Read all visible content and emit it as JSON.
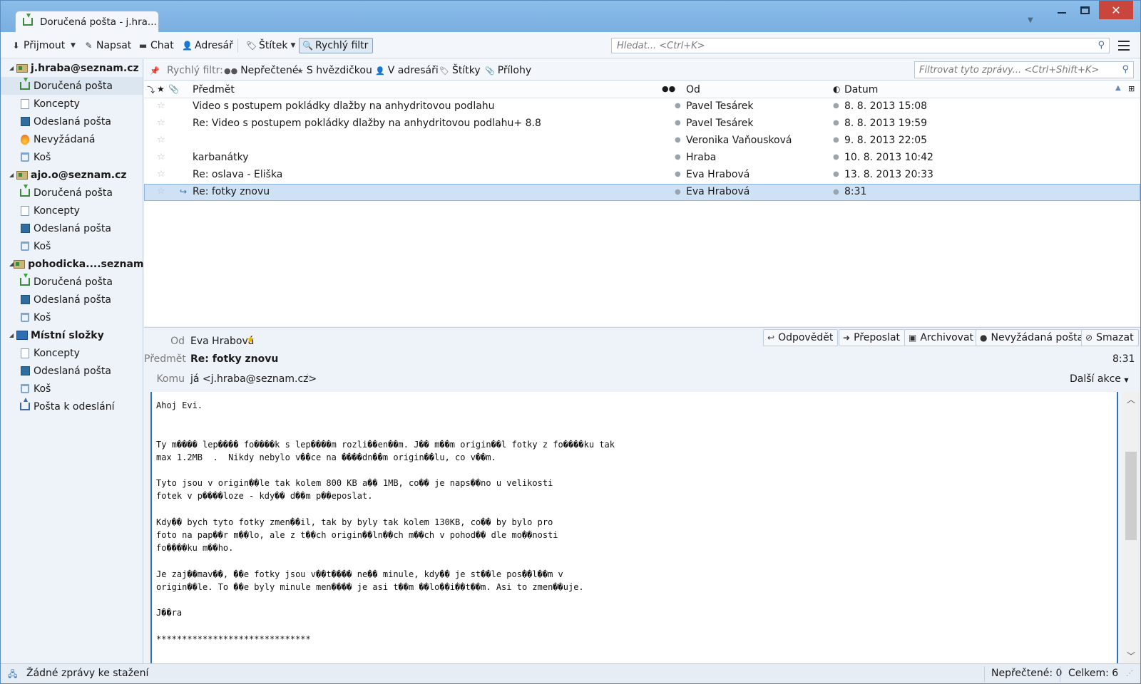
{
  "window": {
    "tab_title": "Doručená pošta - j.hra...",
    "close_glyph": "✕"
  },
  "toolbar": {
    "get_messages": "Přijmout",
    "write": "Napsat",
    "chat": "Chat",
    "address_book": "Adresář",
    "tag": "Štítek",
    "quick_filter": "Rychlý filtr",
    "search_placeholder": "Hledat... <Ctrl+K>"
  },
  "sidebar": {
    "accounts": [
      {
        "name": "j.hraba@seznam.cz",
        "folders": [
          {
            "label": "Doručená pošta",
            "icon": "inbox-icon",
            "selected": true
          },
          {
            "label": "Koncepty",
            "icon": "drafts-icon"
          },
          {
            "label": "Odeslaná pošta",
            "icon": "sent-icon"
          },
          {
            "label": "Nevyžádaná",
            "icon": "junk-icon"
          },
          {
            "label": "Koš",
            "icon": "trash-icon"
          }
        ]
      },
      {
        "name": "ajo.o@seznam.cz",
        "folders": [
          {
            "label": "Doručená pošta",
            "icon": "inbox-icon"
          },
          {
            "label": "Koncepty",
            "icon": "drafts-icon"
          },
          {
            "label": "Odeslaná pošta",
            "icon": "sent-icon"
          },
          {
            "label": "Koš",
            "icon": "trash-icon"
          }
        ]
      },
      {
        "name": "pohodicka....seznam.cz",
        "folders": [
          {
            "label": "Doručená pošta",
            "icon": "inbox-icon"
          },
          {
            "label": "Odeslaná pošta",
            "icon": "sent-icon"
          },
          {
            "label": "Koš",
            "icon": "trash-icon"
          }
        ]
      },
      {
        "name": "Místní složky",
        "folders": [
          {
            "label": "Koncepty",
            "icon": "drafts-icon"
          },
          {
            "label": "Odeslaná pošta",
            "icon": "sent-icon"
          },
          {
            "label": "Koš",
            "icon": "trash-icon"
          },
          {
            "label": "Pošta k odeslání",
            "icon": "outbox-icon"
          }
        ]
      }
    ]
  },
  "quickfilter": {
    "label": "Rychlý filtr:",
    "unread": "Nepřečtené",
    "starred": "S hvězdičkou",
    "contacts": "V adresáři",
    "tags": "Štítky",
    "attachments": "Přílohy",
    "filter_placeholder": "Filtrovat tyto zprávy... <Ctrl+Shift+K>"
  },
  "message_list": {
    "columns": {
      "subject": "Předmět",
      "from": "Od",
      "date": "Datum"
    },
    "rows": [
      {
        "subject": "Video s postupem pokládky dlažby na anhydritovou podlahu",
        "from": "Pavel Tesárek",
        "date": "8. 8. 2013 15:08"
      },
      {
        "subject": "Re: Video s postupem pokládky dlažby na anhydritovou podlahu+ 8.8",
        "from": "Pavel Tesárek",
        "date": "8. 8. 2013 19:59"
      },
      {
        "subject": "",
        "from": "Veronika Vaňousková",
        "date": "9. 8. 2013 22:05"
      },
      {
        "subject": "karbanátky",
        "from": "Hraba",
        "date": "10. 8. 2013 10:42"
      },
      {
        "subject": "Re: oslava - Eliška",
        "from": "Eva Hrabová",
        "date": "13. 8. 2013 20:33"
      },
      {
        "subject": "Re: fotky znovu",
        "from": "Eva Hrabová",
        "date": "8:31",
        "selected": true,
        "replied": true
      }
    ]
  },
  "preview": {
    "from_label": "Od",
    "from_value": "Eva Hrabová",
    "subject_label": "Předmět",
    "subject_value": "Re: fotky znovu",
    "to_label": "Komu",
    "to_value": "já <j.hraba@seznam.cz>",
    "time": "8:31",
    "more_actions": "Další akce",
    "buttons": {
      "reply": "Odpovědět",
      "forward": "Přeposlat",
      "archive": "Archivovat",
      "junk": "Nevyžádaná pošta",
      "delete": "Smazat"
    },
    "body_lines": [
      "Ahoj Evi.",
      "",
      "",
      "Ty m���� lep���� fo����k s lep����m rozli��en��m. J�� m��m origin��l fotky z fo����ku tak",
      "max 1.2MB  .  Nikdy nebylo v��ce na ����dn��m origin��lu, co v��m.",
      "",
      "Tyto jsou v origin��le tak kolem 800 KB a�� 1MB, co�� je naps��no u velikosti",
      "fotek v p����loze - kdy�� d��m p��eposlat.",
      "",
      "Kdy�� bych tyto fotky zmen��il, tak by byly tak kolem 130KB, co�� by bylo pro",
      "foto na pap��r m��lo, ale z t��ch origin��ln��ch m��ch v pohod�� dle mo��nosti",
      "fo����ku m��ho.",
      "",
      "Je zaj��mav��, ��e fotky jsou v��t���� ne�� minule, kdy�� je st��le pos��l��m v",
      "origin��le. To ��e byly minule men���� je asi t��m ��lo��i��t��m. Asi to zmen��uje.",
      "",
      "J��ra",
      "",
      "******************************"
    ]
  },
  "status": {
    "message": "Žádné zprávy ke stažení",
    "unread": "Nepřečtené: 0",
    "total": "Celkem: 6"
  },
  "colors": {
    "accent": "#2e6fb8",
    "selection": "#cfe1f5",
    "close_button": "#c9463d"
  }
}
